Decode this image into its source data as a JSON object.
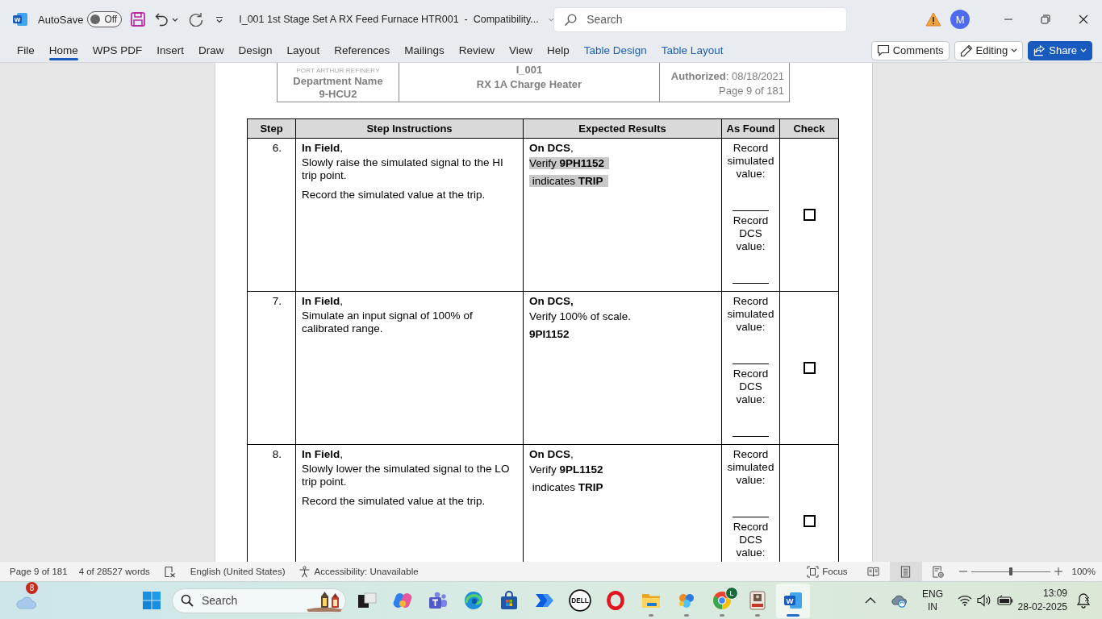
{
  "window": {
    "app_logo": "W",
    "autosave_label": "AutoSave",
    "autosave": {
      "on": false,
      "label": "Off"
    },
    "title": "I_001 1st Stage Set A RX Feed Furnace HTR001  -  Compatibility...",
    "search": {
      "placeholder": "Search"
    },
    "account_initial": "M"
  },
  "ribbon": {
    "tabs": [
      {
        "label": "File",
        "selected": false,
        "contextual": false
      },
      {
        "label": "Home",
        "selected": true,
        "contextual": false
      },
      {
        "label": "WPS PDF",
        "selected": false,
        "contextual": false
      },
      {
        "label": "Insert",
        "selected": false,
        "contextual": false
      },
      {
        "label": "Draw",
        "selected": false,
        "contextual": false
      },
      {
        "label": "Design",
        "selected": false,
        "contextual": false
      },
      {
        "label": "Layout",
        "selected": false,
        "contextual": false
      },
      {
        "label": "References",
        "selected": false,
        "contextual": false
      },
      {
        "label": "Mailings",
        "selected": false,
        "contextual": false
      },
      {
        "label": "Review",
        "selected": false,
        "contextual": false
      },
      {
        "label": "View",
        "selected": false,
        "contextual": false
      },
      {
        "label": "Help",
        "selected": false,
        "contextual": false
      },
      {
        "label": "Table Design",
        "selected": false,
        "contextual": true
      },
      {
        "label": "Table Layout",
        "selected": false,
        "contextual": true
      }
    ],
    "comments": "Comments",
    "editing": "Editing",
    "share": "Share"
  },
  "document": {
    "header": {
      "company": "PORT ARTHUR REFINERY",
      "department": "Department Name",
      "unit": "9-HCU2",
      "procedure": "I_001",
      "equipment": "RX 1A Charge Heater",
      "authorized": "**Authorized**: 08/18/2021",
      "page": "Page 9 of 181"
    },
    "table": {
      "columns": [
        "Step",
        "Step Instructions",
        "Expected Results",
        "As Found",
        "Check"
      ],
      "rows": [
        {
          "step": "6.",
          "instructions": [
            "**In Field**,",
            "Slowly raise the simulated signal to the HI trip point.",
            "Record the simulated value at the trip."
          ],
          "expected": [
            {
              "text": "**On DCS**,",
              "bold": false,
              "highlighted": false
            },
            {
              "text": "Verify **9PH1152**",
              "bold": false,
              "highlighted": true
            },
            {
              "text": " indicates **TRIP**",
              "bold": false,
              "highlighted": true
            }
          ],
          "as_found": [
            {
              "label": "Record simulated value:",
              "fill_line": true
            },
            {
              "label": "Record DCS value:",
              "fill_line": true
            }
          ],
          "checked": false
        },
        {
          "step": "7.",
          "instructions": [
            "**In Field**,",
            "Simulate an input signal of 100% of calibrated range."
          ],
          "expected": [
            {
              "text": "On DCS,",
              "bold": true,
              "highlighted": false
            },
            {
              "text": "Verify 100% of scale.",
              "bold": false,
              "highlighted": false
            },
            {
              "text": "9PI1152",
              "bold": true,
              "highlighted": false
            }
          ],
          "as_found": [
            {
              "label": "Record simulated value:",
              "fill_line": true
            },
            {
              "label": "Record DCS value:",
              "fill_line": true
            }
          ],
          "checked": false
        },
        {
          "step": "8.",
          "instructions": [
            "**In Field**,",
            "Slowly lower the simulated signal to the LO trip point.",
            "Record the simulated value at the trip."
          ],
          "expected": [
            {
              "text": "**On DCS**,",
              "bold": false,
              "highlighted": false
            },
            {
              "text": "Verify **9PL1152**",
              "bold": false,
              "highlighted": false
            },
            {
              "text": " indicates **TRIP**",
              "bold": false,
              "highlighted": false
            }
          ],
          "as_found": [
            {
              "label": "Record simulated value:",
              "fill_line": true
            },
            {
              "label": "Record DCS value:"
            }
          ],
          "checked": false
        }
      ]
    }
  },
  "status_bar": {
    "page": "Page 9 of 181",
    "words": "4 of 28527 words",
    "language": "English (United States)",
    "accessibility": "Accessibility: Unavailable",
    "focus": "Focus",
    "views": [
      {
        "selected": false
      },
      {
        "selected": true
      },
      {
        "selected": false
      }
    ],
    "zoom": {
      "level": 0.5,
      "reading": "100%"
    }
  },
  "taskbar": {
    "weather_badge": "8",
    "search": {
      "placeholder": "Search"
    },
    "apps": [
      {
        "running": false,
        "selected": false
      },
      {
        "running": false,
        "selected": false
      },
      {
        "running": false,
        "selected": false
      },
      {
        "running": false,
        "selected": false
      },
      {
        "running": false,
        "selected": false
      },
      {
        "running": false,
        "selected": false
      },
      {
        "running": false,
        "selected": false,
        "logo_text": "DELL"
      },
      {
        "running": false,
        "selected": false
      },
      {
        "running": true,
        "selected": false
      },
      {
        "running": true,
        "selected": false
      },
      {
        "running": true,
        "selected": false,
        "badge": "L"
      },
      {
        "running": true,
        "selected": false
      },
      {
        "running": true,
        "selected": true,
        "logo_text": "W"
      }
    ],
    "tray": {
      "language": "ENG",
      "region": "IN",
      "time": "13:09",
      "date": "28-02-2025"
    }
  }
}
